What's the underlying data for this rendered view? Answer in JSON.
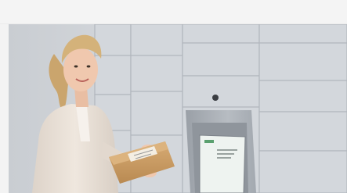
{
  "image": {
    "scene": "parcel-locker",
    "colors": {
      "locker": "#cfd3d8",
      "locker_shadow": "#b9bec5",
      "panel": "#aeb4bb",
      "screen": "#eef3f0",
      "screen_brand": "#5aa06f",
      "parcel": "#c99a62",
      "parcel_dark": "#a87a45",
      "hair": "#d4b27a",
      "skin": "#f0c8ae",
      "jacket": "#ece3da"
    }
  }
}
